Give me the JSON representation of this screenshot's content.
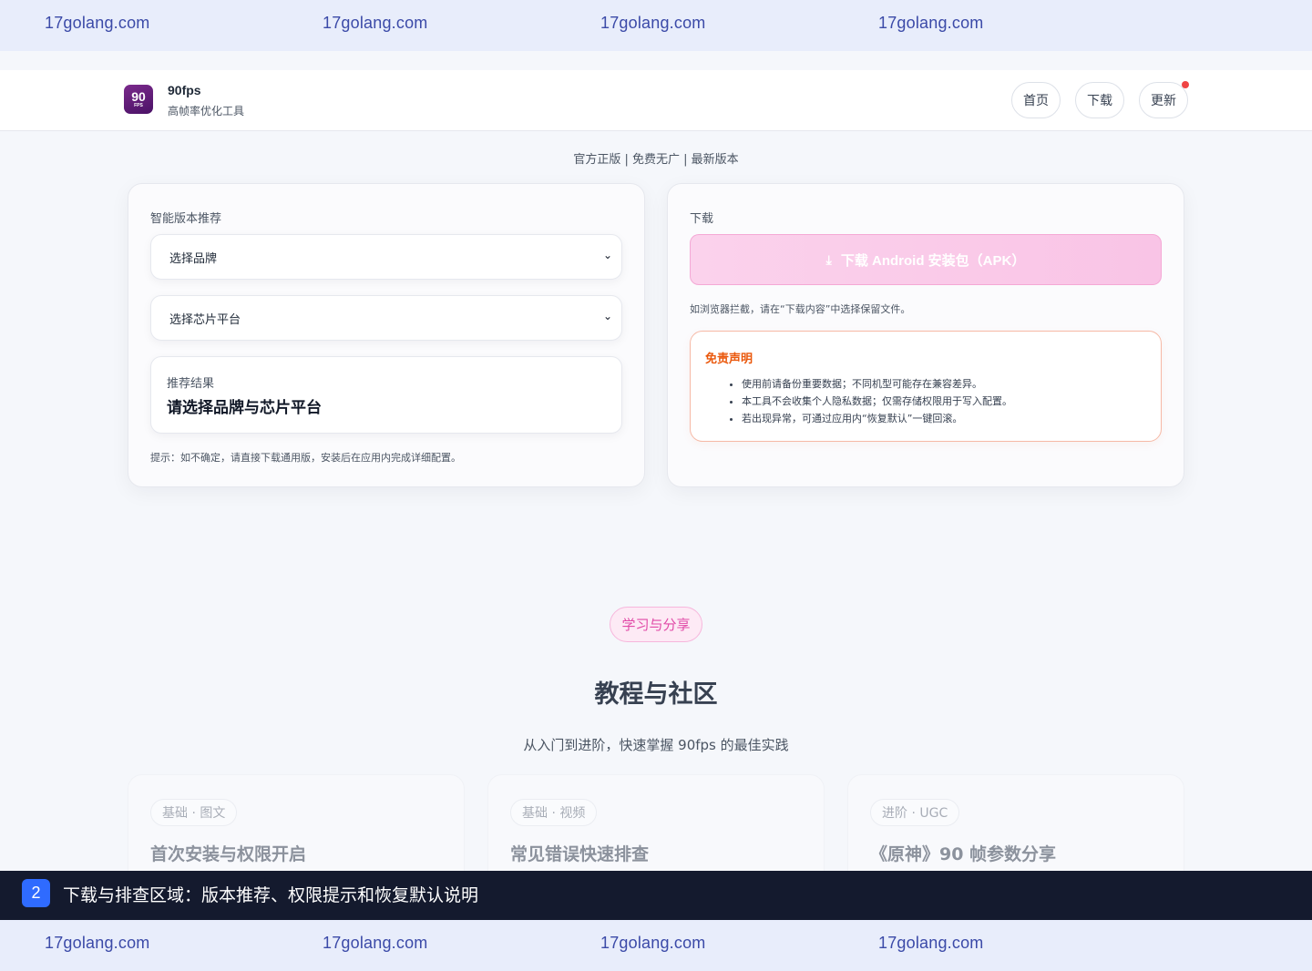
{
  "watermark": {
    "text": "17golang.com"
  },
  "header": {
    "logo_top": "90",
    "logo_bottom": "FPS",
    "brand_name": "90fps",
    "brand_sub": "高帧率优化工具",
    "nav": [
      {
        "label": "首页"
      },
      {
        "label": "下载"
      },
      {
        "label": "更新"
      }
    ]
  },
  "tagline": "官方正版 | 免费无广 | 最新版本",
  "recommend": {
    "title": "智能版本推荐",
    "brand_select": "选择品牌",
    "chip_select": "选择芯片平台",
    "result_label": "推荐结果",
    "result_value": "请选择品牌与芯片平台",
    "hint": "提示：如不确定，请直接下载通用版，安装后在应用内完成详细配置。"
  },
  "download": {
    "title": "下载",
    "button_label": "下载 Android 安装包（APK）",
    "note": "如浏览器拦截，请在“下载内容”中选择保留文件。",
    "disclaimer_title": "免责声明",
    "disclaimer_items": [
      "使用前请备份重要数据；不同机型可能存在兼容差异。",
      "本工具不会收集个人隐私数据；仅需存储权限用于写入配置。",
      "若出现异常，可通过应用内“恢复默认”一键回滚。"
    ]
  },
  "community": {
    "pill": "学习与分享",
    "title": "教程与社区",
    "subtitle": "从入门到进阶，快速掌握 90fps 的最佳实践",
    "cards": [
      {
        "tag": "基础 · 图文",
        "title": "首次安装与权限开启"
      },
      {
        "tag": "基础 · 视频",
        "title": "常见错误快速排查"
      },
      {
        "tag": "进阶 · UGC",
        "title": "《原神》90 帧参数分享"
      }
    ]
  },
  "caption": {
    "number": "2",
    "text": "下载与排查区域：版本推荐、权限提示和恢复默认说明"
  },
  "colors": {
    "accent_pink": "#f9c4e6",
    "disclaimer_orange": "#ea580c",
    "notification_red": "#ef4444",
    "caption_bg": "#141a2e"
  }
}
